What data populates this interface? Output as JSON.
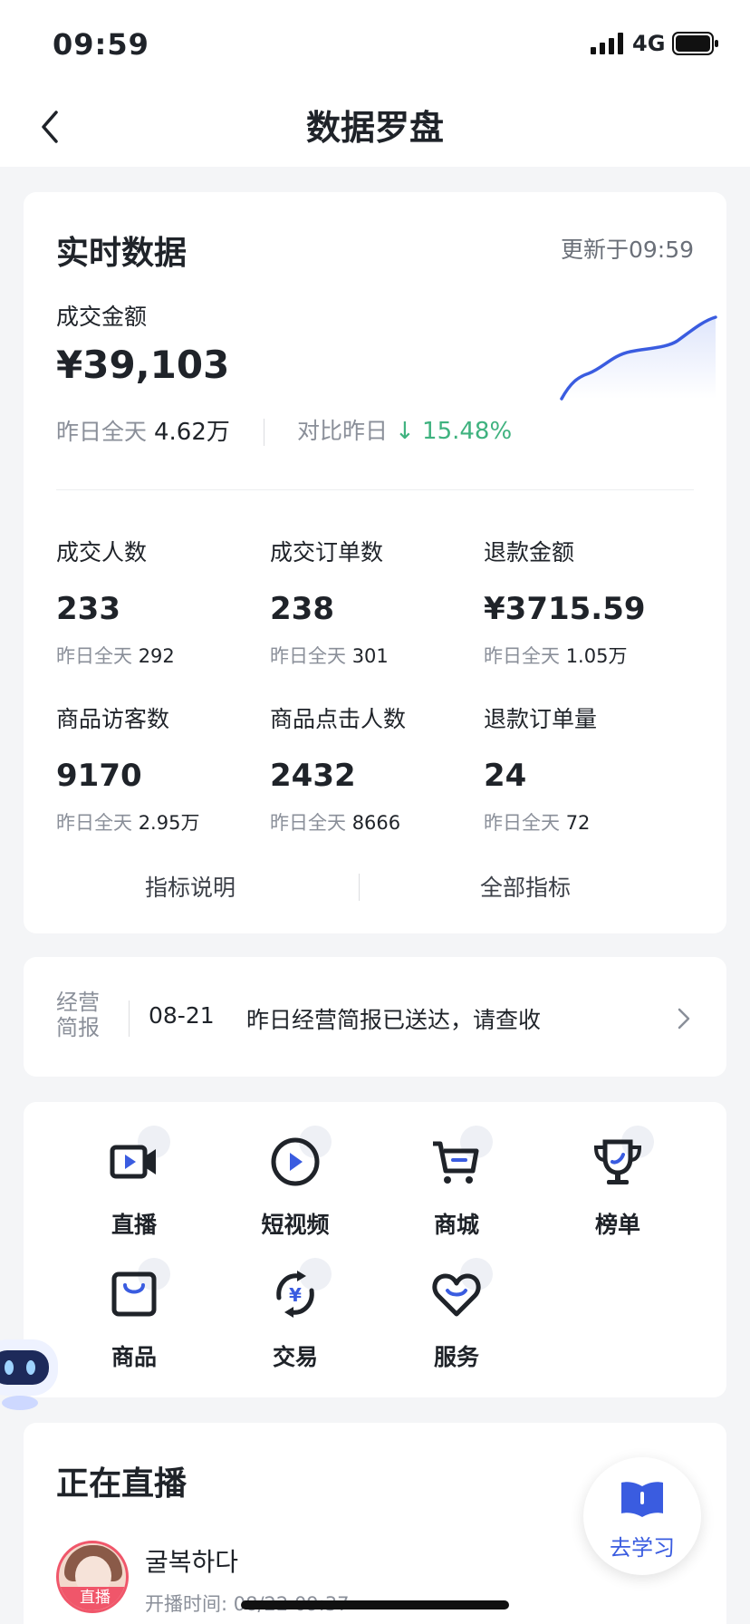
{
  "status_bar": {
    "time": "09:59",
    "network": "4G"
  },
  "nav": {
    "title": "数据罗盘"
  },
  "realtime": {
    "heading": "实时数据",
    "update": "更新于09:59",
    "gmv_label": "成交金额",
    "gmv_value": "¥39,103",
    "yesterday_label": "昨日全天",
    "yesterday_value": "4.62万",
    "compare_label": "对比昨日",
    "compare_value": "15.48%",
    "compare_icon": "arrow-down-icon",
    "metrics": [
      {
        "label": "成交人数",
        "value": "233",
        "ystd_label": "昨日全天",
        "ystd_value": "292"
      },
      {
        "label": "成交订单数",
        "value": "238",
        "ystd_label": "昨日全天",
        "ystd_value": "301"
      },
      {
        "label": "退款金额",
        "value": "¥3715.59",
        "ystd_label": "昨日全天",
        "ystd_value": "1.05万"
      },
      {
        "label": "商品访客数",
        "value": "9170",
        "ystd_label": "昨日全天",
        "ystd_value": "2.95万"
      },
      {
        "label": "商品点击人数",
        "value": "2432",
        "ystd_label": "昨日全天",
        "ystd_value": "8666"
      },
      {
        "label": "退款订单量",
        "value": "24",
        "ystd_label": "昨日全天",
        "ystd_value": "72"
      }
    ],
    "link_explain": "指标说明",
    "link_all": "全部指标"
  },
  "report": {
    "tag": "经营简报",
    "date": "08-21",
    "message": "昨日经营简报已送达，请查收"
  },
  "entries": [
    {
      "label": "直播",
      "icon": "live-camera-icon"
    },
    {
      "label": "短视频",
      "icon": "play-icon"
    },
    {
      "label": "商城",
      "icon": "cart-icon"
    },
    {
      "label": "榜单",
      "icon": "trophy-icon"
    },
    {
      "label": "商品",
      "icon": "bag-icon"
    },
    {
      "label": "交易",
      "icon": "yuan-exchange-icon"
    },
    {
      "label": "服务",
      "icon": "heart-service-icon"
    }
  ],
  "live": {
    "heading": "正在直播",
    "badge": "直播",
    "name": "굴복하다",
    "start_label": "开播时间: 08/22 09:37"
  },
  "learn": {
    "label": "去学习"
  },
  "colors": {
    "accent": "#3a5ce0",
    "down": "#3fb27f",
    "live_badge": "#f0566a"
  }
}
